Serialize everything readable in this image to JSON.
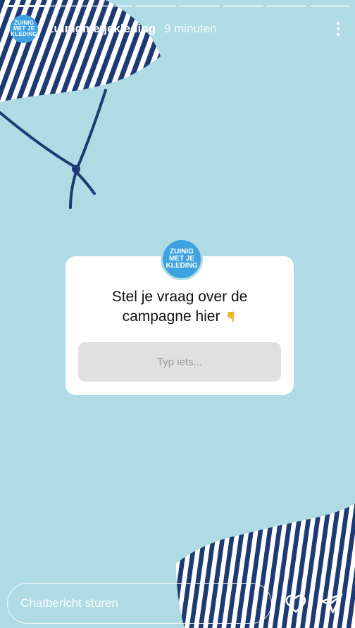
{
  "story": {
    "progress_segments": 8,
    "active_segment": 1
  },
  "header": {
    "avatar_logo_lines": [
      "ZUINIG",
      "MET JE",
      "KLEDING"
    ],
    "username": "zuinigmetjekleding",
    "time": "9 minuten"
  },
  "question_sticker": {
    "line1": "Stel je vraag over de",
    "line2": "campagne hier",
    "hand_emoji": "☛",
    "placeholder": "Typ iets..."
  },
  "footer": {
    "message_placeholder": "Chatbericht sturen",
    "like_icon": "heart-icon",
    "send_icon": "paper-plane-icon"
  },
  "colors": {
    "background": "#aedbe4",
    "stripe": "#1d3a73",
    "logo_blue": "#3ea2e0"
  }
}
